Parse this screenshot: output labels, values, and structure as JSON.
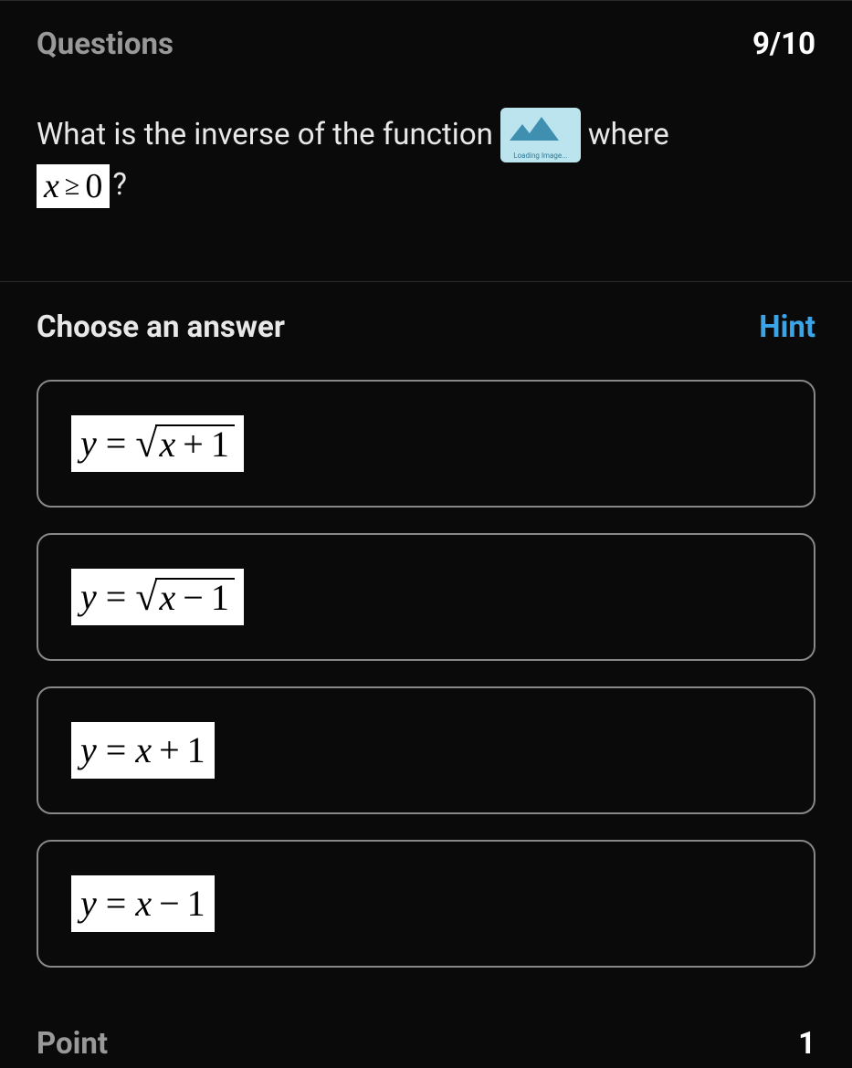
{
  "header": {
    "questions_label": "Questions",
    "progress": "9/10"
  },
  "question": {
    "prefix": "What is the inverse of the function ",
    "loading_text": "Loading Image...",
    "suffix": " where",
    "condition_math": "x ≥ 0",
    "condition_x": "x",
    "condition_zero": "0",
    "trailing": "?"
  },
  "choose": {
    "label": "Choose an answer",
    "hint_label": "Hint"
  },
  "answers": [
    {
      "display": "y = √(x + 1)",
      "y": "y",
      "type": "sqrt",
      "a": "x",
      "op": "+",
      "b": "1"
    },
    {
      "display": "y = √(x − 1)",
      "y": "y",
      "type": "sqrt",
      "a": "x",
      "op": "−",
      "b": "1"
    },
    {
      "display": "y = x + 1",
      "y": "y",
      "type": "linear",
      "a": "x",
      "op": "+",
      "b": "1"
    },
    {
      "display": "y = x − 1",
      "y": "y",
      "type": "linear",
      "a": "x",
      "op": "−",
      "b": "1"
    }
  ],
  "point": {
    "label": "Point",
    "value": "1"
  }
}
